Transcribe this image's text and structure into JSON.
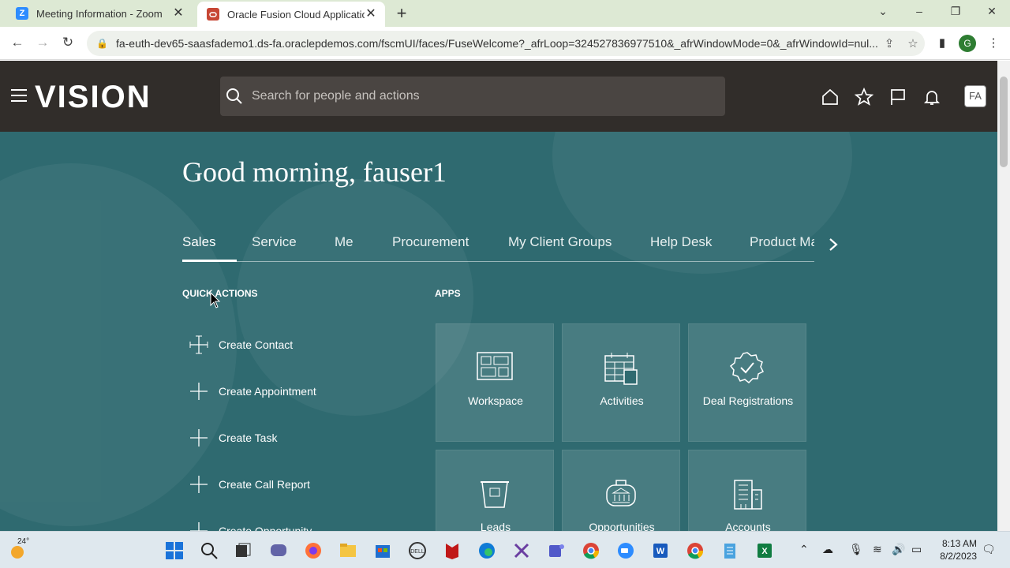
{
  "browser": {
    "tabs": [
      {
        "title": "Meeting Information - Zoom",
        "favicon": "zoom-icon",
        "color": "#2d8cff"
      },
      {
        "title": "Oracle Fusion Cloud Applications",
        "favicon": "oracle-icon",
        "color": "#c74634"
      }
    ],
    "url": "fa-euth-dev65-saasfademo1.ds-fa.oraclepdemos.com/fscmUI/faces/FuseWelcome?_afrLoop=324527836977510&_afrWindowMode=0&_afrWindowId=nul...",
    "profile_initial": "G"
  },
  "app": {
    "logo": "VISION",
    "search_placeholder": "Search for people and actions",
    "avatar": "FA",
    "greeting": "Good morning, fauser1",
    "nav_tabs": [
      "Sales",
      "Service",
      "Me",
      "Procurement",
      "My Client Groups",
      "Help Desk",
      "Product Ma"
    ],
    "active_tab": "Sales",
    "quick_actions_title": "QUICK ACTIONS",
    "quick_actions": [
      "Create Contact",
      "Create Appointment",
      "Create Task",
      "Create Call Report",
      "Create Opportunity"
    ],
    "apps_title": "APPS",
    "apps": [
      "Workspace",
      "Activities",
      "Deal Registrations",
      "Leads",
      "Opportunities",
      "Accounts"
    ],
    "colors": {
      "header": "#312d2a",
      "main": "#2f6a70"
    }
  },
  "taskbar": {
    "weather_temp": "24°",
    "time": "8:13 AM",
    "date": "8/2/2023"
  }
}
